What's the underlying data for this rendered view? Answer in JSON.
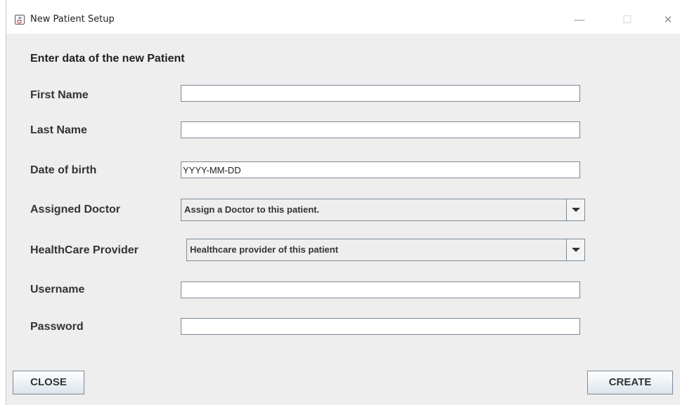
{
  "window": {
    "title": "New Patient Setup",
    "icon": "java-cup-icon",
    "controls": {
      "minimize": "—",
      "maximize": "☐",
      "close": "✕"
    }
  },
  "form": {
    "heading": "Enter data of the new Patient",
    "first_name": {
      "label": "First Name",
      "value": ""
    },
    "last_name": {
      "label": "Last Name",
      "value": ""
    },
    "date_of_birth": {
      "label": "Date of birth",
      "value": "YYYY-MM-DD"
    },
    "assigned_doctor": {
      "label": "Assigned Doctor",
      "selected": "Assign a Doctor to this patient."
    },
    "healthcare_provider": {
      "label": "HealthCare Provider",
      "selected": "Healthcare provider of this patient"
    },
    "username": {
      "label": "Username",
      "value": ""
    },
    "password": {
      "label": "Password",
      "value": ""
    }
  },
  "buttons": {
    "close_label": "CLOSE",
    "create_label": "CREATE"
  }
}
